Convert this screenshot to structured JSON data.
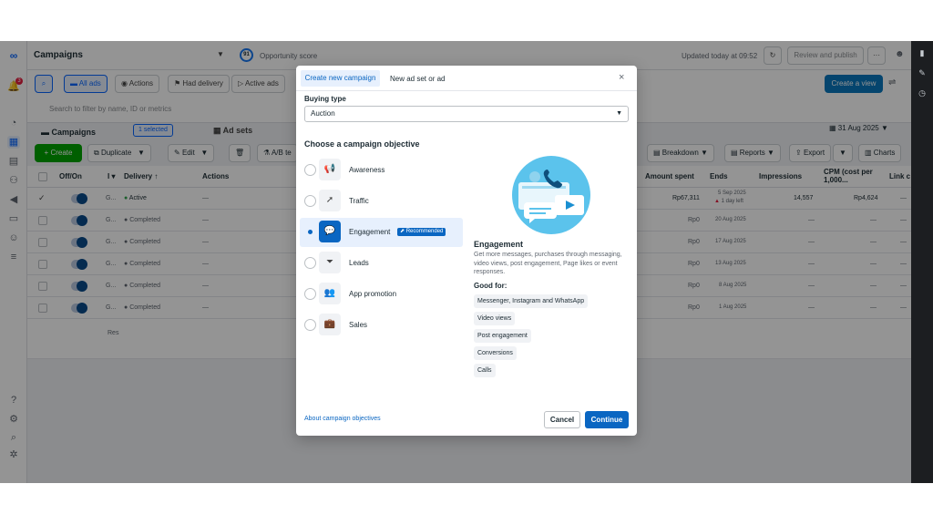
{
  "app": {
    "title": "Campaigns",
    "opportunity_score_value": "91",
    "opportunity_score_label": "Opportunity score",
    "updated": "Updated today at 09:52",
    "review_publish": "Review and publish",
    "more": "···",
    "notification_count": "3"
  },
  "toolbar": {
    "all_ads": "All ads",
    "actions": "Actions",
    "had_delivery": "Had delivery",
    "active_ads": "Active ads",
    "search_placeholder": "Search to filter by name, ID or metrics",
    "create_view": "Create a view"
  },
  "tabs": {
    "campaigns": "Campaigns",
    "selected": "1 selected",
    "ad_sets": "Ad sets",
    "date": "31 Aug 2025"
  },
  "actions_row": {
    "create": "Create",
    "duplicate": "Duplicate",
    "edit": "Edit",
    "ab_test": "A/B te",
    "breakdown": "Breakdown",
    "reports": "Reports",
    "export": "Export",
    "charts": "Charts"
  },
  "table": {
    "headers": {
      "off_on": "Off/On",
      "delivery": "Delivery ↑",
      "actions": "Actions",
      "amount_spent": "Amount spent",
      "ends": "Ends",
      "impressions": "Impressions",
      "cpm": "CPM (cost per 1,000...",
      "link": "Link c"
    },
    "rows": [
      {
        "name": "G...",
        "delivery": "Active",
        "actions": "—",
        "amount": "Rp67,311",
        "ends": "5 Sep 2025",
        "ends_sub": "1 day left",
        "impressions": "14,557",
        "cpm": "Rp4,624",
        "link": "—"
      },
      {
        "name": "G...",
        "delivery": "Completed",
        "actions": "—",
        "amount": "Rp0",
        "ends": "20 Aug 2025",
        "impressions": "—",
        "cpm": "—",
        "link": "—"
      },
      {
        "name": "G...",
        "delivery": "Completed",
        "actions": "—",
        "amount": "Rp0",
        "ends": "17 Aug 2025",
        "impressions": "—",
        "cpm": "—",
        "link": "—"
      },
      {
        "name": "G...",
        "delivery": "Completed",
        "actions": "—",
        "amount": "Rp0",
        "ends": "13 Aug 2025",
        "impressions": "—",
        "cpm": "—",
        "link": "—"
      },
      {
        "name": "G...",
        "delivery": "Completed",
        "actions": "—",
        "amount": "Rp0",
        "ends": "8 Aug 2025",
        "impressions": "—",
        "cpm": "—",
        "link": "—"
      },
      {
        "name": "G...",
        "delivery": "Completed",
        "actions": "—",
        "amount": "Rp0",
        "ends": "1 Aug 2025",
        "impressions": "—",
        "cpm": "—",
        "link": "—"
      }
    ],
    "results_label": "Res"
  },
  "modal": {
    "tab_new_campaign": "Create new campaign",
    "tab_new_adset": "New ad set or ad",
    "close": "×",
    "buying_type_label": "Buying type",
    "buying_type_value": "Auction",
    "choose_objective": "Choose a campaign objective",
    "objectives": [
      {
        "label": "Awareness",
        "icon": "megaphone-icon"
      },
      {
        "label": "Traffic",
        "icon": "cursor-icon"
      },
      {
        "label": "Engagement",
        "icon": "chat-bubbles-icon"
      },
      {
        "label": "Leads",
        "icon": "funnel-icon"
      },
      {
        "label": "App promotion",
        "icon": "people-icon"
      },
      {
        "label": "Sales",
        "icon": "briefcase-icon"
      }
    ],
    "recommended": "Recommended",
    "detail_title": "Engagement",
    "detail_desc": "Get more messages, purchases through messaging, video views, post engagement, Page likes or event responses.",
    "good_for": "Good for:",
    "good_for_items": [
      "Messenger, Instagram and WhatsApp",
      "Video views",
      "Post engagement",
      "Conversions",
      "Calls"
    ],
    "about_link": "About campaign objectives",
    "cancel": "Cancel",
    "continue": "Continue"
  },
  "colors": {
    "primary": "#0a66c2",
    "create_green": "#00a400",
    "selected_bg": "#e7f0fd"
  }
}
